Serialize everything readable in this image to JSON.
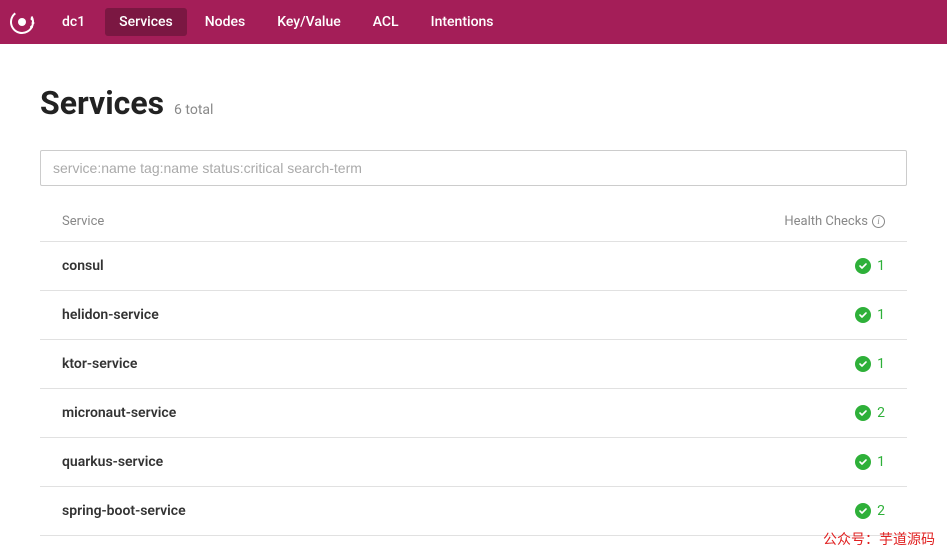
{
  "nav": {
    "datacenter": "dc1",
    "items": [
      {
        "label": "Services",
        "active": true
      },
      {
        "label": "Nodes",
        "active": false
      },
      {
        "label": "Key/Value",
        "active": false
      },
      {
        "label": "ACL",
        "active": false
      },
      {
        "label": "Intentions",
        "active": false
      }
    ]
  },
  "page": {
    "title": "Services",
    "subtitle": "6 total"
  },
  "search": {
    "placeholder": "service:name tag:name status:critical search-term",
    "value": ""
  },
  "table": {
    "col_service": "Service",
    "col_health": "Health Checks"
  },
  "services": [
    {
      "name": "consul",
      "health_count": "1"
    },
    {
      "name": "helidon-service",
      "health_count": "1"
    },
    {
      "name": "ktor-service",
      "health_count": "1"
    },
    {
      "name": "micronaut-service",
      "health_count": "2"
    },
    {
      "name": "quarkus-service",
      "health_count": "1"
    },
    {
      "name": "spring-boot-service",
      "health_count": "2"
    }
  ],
  "watermark": "公众号：芋道源码"
}
